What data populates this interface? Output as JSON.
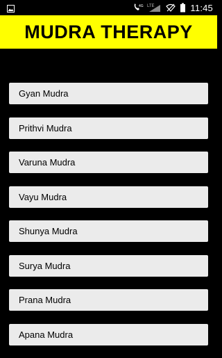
{
  "status_bar": {
    "time": "11:45",
    "network_label": "LTE",
    "network_type": "4G",
    "icons": [
      "image-notification-icon",
      "phone-signal-icon",
      "lte-signal-icon",
      "wifi-off-icon",
      "battery-icon"
    ]
  },
  "header": {
    "title": "MUDRA THERAPY",
    "background": "#ffff00"
  },
  "list": {
    "items": [
      {
        "label": "Gyan Mudra"
      },
      {
        "label": "Prithvi Mudra"
      },
      {
        "label": "Varuna Mudra"
      },
      {
        "label": "Vayu Mudra"
      },
      {
        "label": "Shunya Mudra"
      },
      {
        "label": "Surya Mudra"
      },
      {
        "label": "Prana Mudra"
      },
      {
        "label": "Apana Mudra"
      }
    ]
  }
}
